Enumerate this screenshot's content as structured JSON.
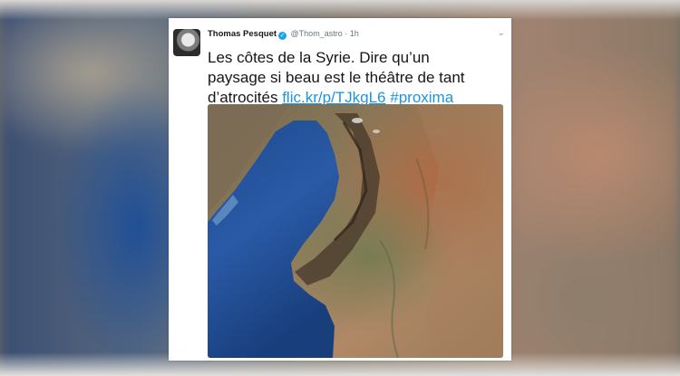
{
  "tweet": {
    "author_name": "Thomas Pesquet",
    "handle": "@Thom_astro",
    "separator": "·",
    "time": "1h",
    "text_lines": [
      "Les côtes de la Syrie. Dire qu’un",
      "paysage si beau est le théâtre de tant",
      "d’atrocités "
    ],
    "link": "flic.kr/p/TJkgL6",
    "hashtag": "#proxima"
  },
  "icons": {
    "verified": "verified-badge-icon",
    "menu": "chevron-down-icon"
  },
  "colors": {
    "link": "#1b95e0",
    "verified": "#1da1f2",
    "text": "#14171a",
    "meta": "#66757f",
    "sea": "#1f4f96",
    "land": "#8a6d4e"
  }
}
